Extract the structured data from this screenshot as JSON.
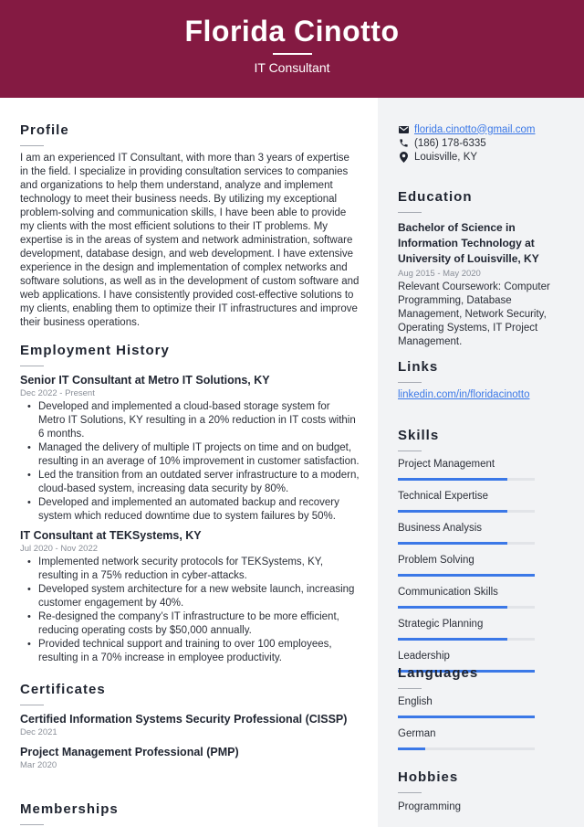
{
  "header": {
    "name": "Florida Cinotto",
    "title": "IT Consultant",
    "background_color": "#841a42"
  },
  "profile": {
    "heading": "Profile",
    "text": "I am an experienced IT Consultant, with more than 3 years of expertise in the field. I specialize in providing consultation services to companies and organizations to help them understand, analyze and implement technology to meet their business needs. By utilizing my exceptional problem-solving and communication skills, I have been able to provide my clients with the most efficient solutions to their IT problems. My expertise is in the areas of system and network administration, software development, database design, and web development. I have extensive experience in the design and implementation of complex networks and software solutions, as well as in the development of custom software and web applications. I have consistently provided cost-effective solutions to my clients, enabling them to optimize their IT infrastructures and improve their business operations."
  },
  "employment": {
    "heading": "Employment History",
    "jobs": [
      {
        "title": "Senior IT Consultant at Metro IT Solutions, KY",
        "dates": "Dec 2022 - Present",
        "bullets": [
          "Developed and implemented a cloud-based storage system for Metro IT Solutions, KY resulting in a 20% reduction in IT costs within 6 months.",
          "Managed the delivery of multiple IT projects on time and on budget, resulting in an average of 10% improvement in customer satisfaction.",
          "Led the transition from an outdated server infrastructure to a modern, cloud-based system, increasing data security by 80%.",
          "Developed and implemented an automated backup and recovery system which reduced downtime due to system failures by 50%."
        ]
      },
      {
        "title": "IT Consultant at TEKSystems, KY",
        "dates": "Jul 2020 - Nov 2022",
        "bullets": [
          "Implemented network security protocols for TEKSystems, KY, resulting in a 75% reduction in cyber-attacks.",
          "Developed system architecture for a new website launch, increasing customer engagement by 40%.",
          "Re-designed the company’s IT infrastructure to be more efficient, reducing operating costs by $50,000 annually.",
          "Provided technical support and training to over 100 employees, resulting in a 70% increase in employee productivity."
        ]
      }
    ]
  },
  "certificates": {
    "heading": "Certificates",
    "items": [
      {
        "name": "Certified Information Systems Security Professional (CISSP)",
        "date": "Dec 2021"
      },
      {
        "name": "Project Management Professional (PMP)",
        "date": "Mar 2020"
      }
    ]
  },
  "memberships": {
    "heading": "Memberships"
  },
  "contact": {
    "email": "florida.cinotto@gmail.com",
    "phone": "(186) 178-6335",
    "location": "Louisville, KY",
    "icons": [
      "envelope-icon",
      "phone-icon",
      "map-pin-icon"
    ]
  },
  "education": {
    "heading": "Education",
    "degree": "Bachelor of Science in Information Technology at University of Louisville, KY",
    "dates": "Aug 2015 - May 2020",
    "description": "Relevant Coursework: Computer Programming, Database Management, Network Security, Operating Systems, IT Project Management."
  },
  "links": {
    "heading": "Links",
    "items": [
      "linkedin.com/in/floridacinotto"
    ]
  },
  "skills": {
    "heading": "Skills",
    "accent_color": "#3b78e7",
    "items": [
      {
        "name": "Project Management",
        "level": 0.8
      },
      {
        "name": "Technical Expertise",
        "level": 0.8
      },
      {
        "name": "Business Analysis",
        "level": 0.8
      },
      {
        "name": "Problem Solving",
        "level": 1.0
      },
      {
        "name": "Communication Skills",
        "level": 0.8
      },
      {
        "name": "Strategic Planning",
        "level": 0.8
      },
      {
        "name": "Leadership",
        "level": 1.0
      }
    ]
  },
  "languages": {
    "heading": "Languages",
    "items": [
      {
        "name": "English",
        "level": 1.0
      },
      {
        "name": "German",
        "level": 0.2
      }
    ]
  },
  "hobbies": {
    "heading": "Hobbies",
    "items": [
      "Programming"
    ]
  }
}
